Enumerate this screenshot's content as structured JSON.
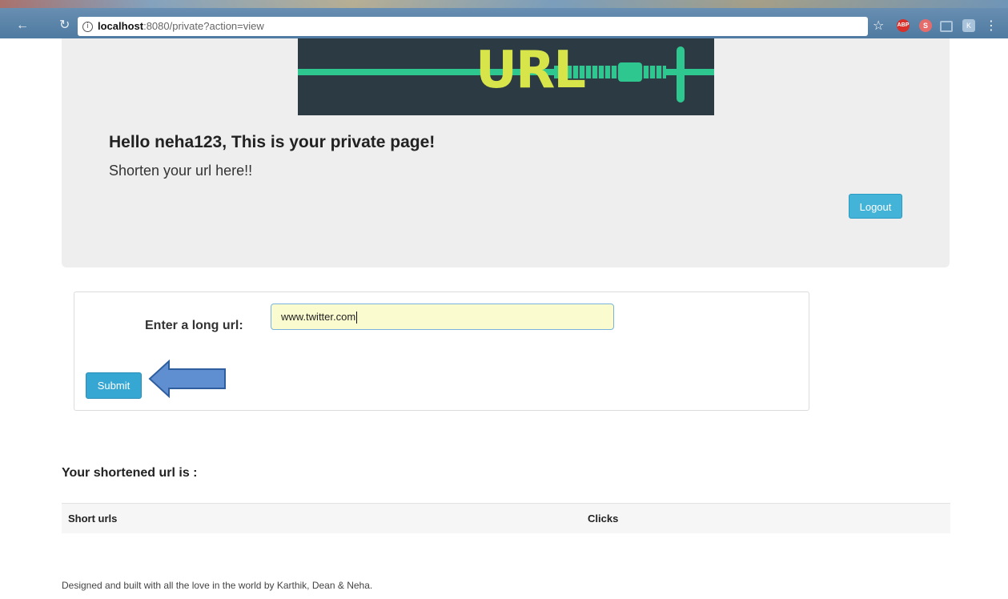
{
  "browser": {
    "url_host": "localhost",
    "url_rest": ":8080/private?action=view",
    "back_icon": "back-arrow-icon",
    "reload_icon": "reload-icon",
    "bookmark_icon": "star-icon",
    "extensions": [
      "ABP",
      "S",
      "cast",
      "K"
    ]
  },
  "header": {
    "banner_text": "URL",
    "greeting": "Hello neha123, This is your private page!",
    "subtitle": "Shorten your url here!!",
    "logout_label": "Logout"
  },
  "form": {
    "label": "Enter a long url:",
    "input_value": "www.twitter.com",
    "submit_label": "Submit"
  },
  "results": {
    "title": "Your shortened url is :",
    "columns": [
      "Short urls",
      "Clicks"
    ],
    "rows": []
  },
  "footer": {
    "text": "Designed and built with all the love in the world by Karthik, Dean & Neha."
  },
  "colors": {
    "button_blue": "#36a6d3",
    "input_bg": "#fbfbd0",
    "jumbotron_bg": "#eeeeee",
    "arrow_fill": "#5f8fd0"
  }
}
